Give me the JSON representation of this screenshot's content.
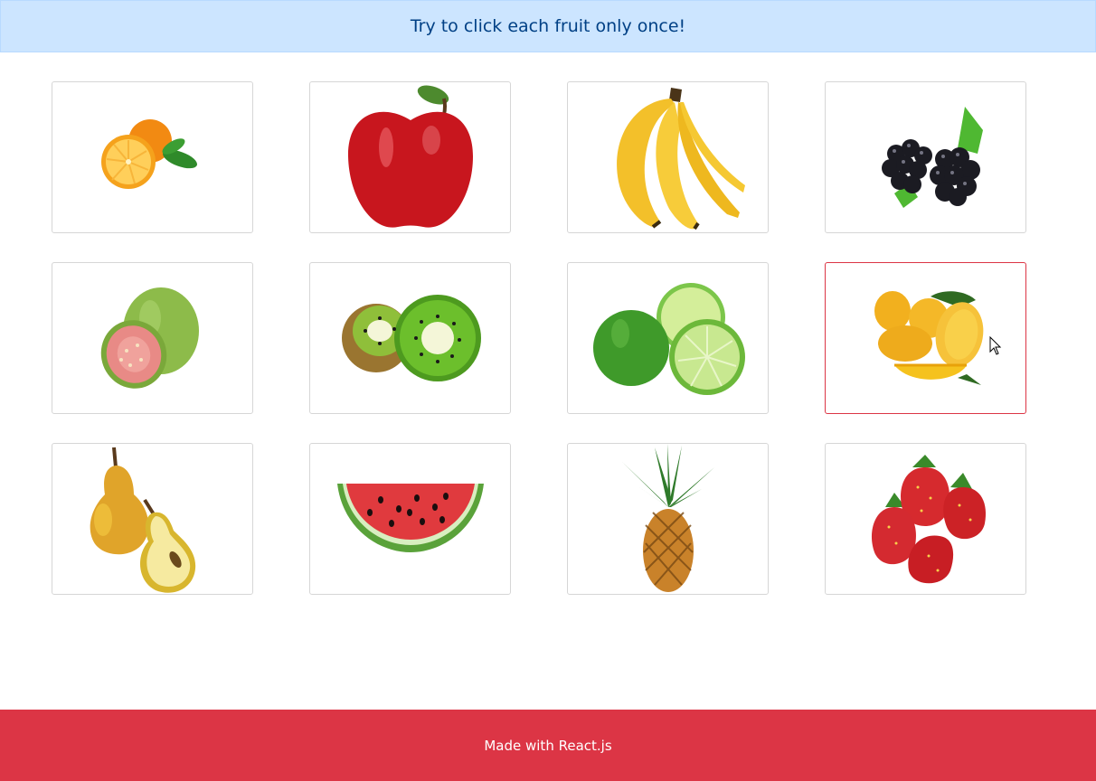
{
  "banner": {
    "message": "Try to click each fruit only once!"
  },
  "fruits": [
    {
      "icon": "orange-icon",
      "name": "orange"
    },
    {
      "icon": "apple-icon",
      "name": "apple"
    },
    {
      "icon": "banana-icon",
      "name": "banana"
    },
    {
      "icon": "blackberry-icon",
      "name": "blackberry"
    },
    {
      "icon": "guava-icon",
      "name": "guava"
    },
    {
      "icon": "kiwi-icon",
      "name": "kiwi"
    },
    {
      "icon": "lime-icon",
      "name": "lime"
    },
    {
      "icon": "mango-icon",
      "name": "mango"
    },
    {
      "icon": "pear-icon",
      "name": "pear"
    },
    {
      "icon": "watermelon-icon",
      "name": "watermelon"
    },
    {
      "icon": "pineapple-icon",
      "name": "pineapple"
    },
    {
      "icon": "strawberry-icon",
      "name": "strawberry"
    }
  ],
  "hovered_fruit": "mango",
  "footer": {
    "credit": "Made with React.js"
  },
  "colors": {
    "banner_bg": "#cce5ff",
    "banner_text": "#004085",
    "footer_bg": "#dc3545",
    "hover_border": "#dc3545"
  }
}
